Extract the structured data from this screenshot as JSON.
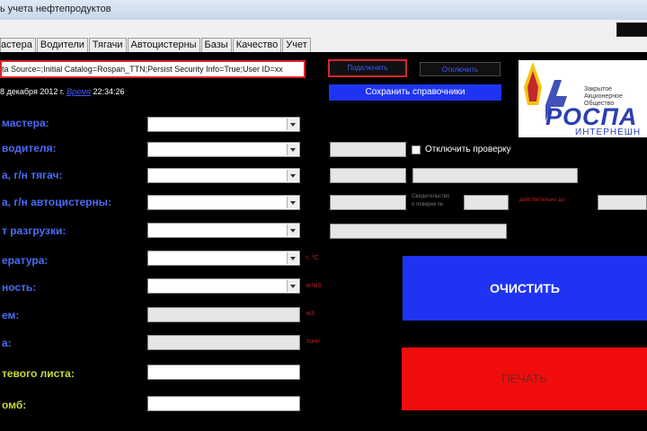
{
  "window": {
    "title": "ь учета нефтепродуктов"
  },
  "tabs": [
    "астера",
    "Водители",
    "Тягачи",
    "Автоцистерны",
    "Базы",
    "Качество",
    "Учет"
  ],
  "connection": {
    "string": "ta Source=;Initial Catalog=Rospan_TTN;Persist Security Info=True;User ID=xx",
    "connect_label": "Подключить",
    "disconnect_label": "Отключить",
    "save_label": "Сохранить справочники"
  },
  "datetime": {
    "date": "8 декабря 2012 г.",
    "link": "Время",
    "time": "22:34:26"
  },
  "logo": {
    "line1": "Закрытое",
    "line2": "Акционерное",
    "line3": "Общество",
    "brand": "РОСПА",
    "sub": "ИНТЕРНЕШН"
  },
  "form": {
    "master_label": "мастера:",
    "driver_label": "водителя:",
    "tractor_label": "а, г/н тягач:",
    "tanker_label": "а, г/н автоцистерны:",
    "unload_label": "т разгрузки:",
    "temp_label": "ература:",
    "density_label": "ность:",
    "volume_label": "ем:",
    "mass_label": "а:",
    "waybill_label": "тевого листа:",
    "seals_label": "омб:",
    "disable_check_label": "Отключить проверку",
    "certificate_label_1": "Свидетельство",
    "certificate_label_2": "о поверке №",
    "valid_until_label": "действительно до",
    "unit_temp": "t, ºC",
    "unit_density": "кг/м3",
    "unit_volume": "м3",
    "unit_mass": "тонн"
  },
  "buttons": {
    "clear_label": "ОЧИСТИТЬ",
    "print_label": "ПЕЧАТЬ"
  },
  "colors": {
    "background": "#000000",
    "accent_blue": "#1f34f2",
    "print_red": "#f20d0d",
    "label_blue": "#4a6cf5",
    "label_yellow": "#c8d83a"
  }
}
